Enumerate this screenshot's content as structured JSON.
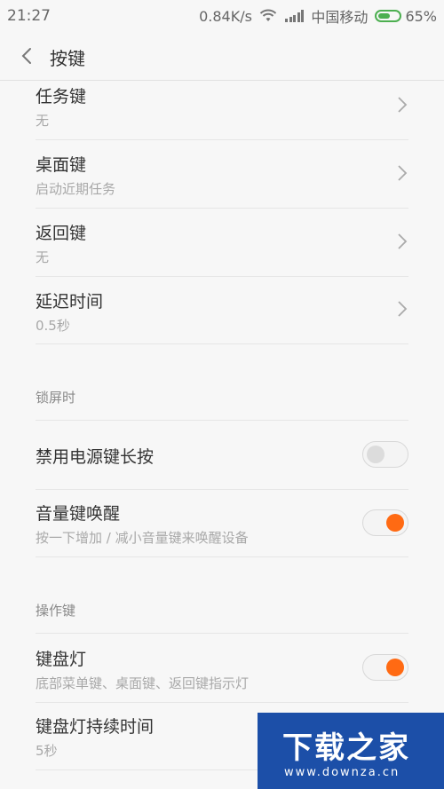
{
  "status_bar": {
    "time": "21:27",
    "speed": "0.84K/s",
    "carrier": "中国移动",
    "battery": "65%",
    "battery_level": 0.65
  },
  "header": {
    "title": "按键"
  },
  "items": [
    {
      "label": "任务键",
      "sub": "无"
    },
    {
      "label": "桌面键",
      "sub": "启动近期任务"
    },
    {
      "label": "返回键",
      "sub": "无"
    },
    {
      "label": "延迟时间",
      "sub": "0.5秒"
    }
  ],
  "lock_section": {
    "title": "锁屏时",
    "items": [
      {
        "label": "禁用电源键长按",
        "toggle": false
      },
      {
        "label": "音量键唤醒",
        "sub": "按一下增加 / 减小音量键来唤醒设备",
        "toggle": true
      }
    ]
  },
  "ops_section": {
    "title": "操作键",
    "items": [
      {
        "label": "键盘灯",
        "sub": "底部菜单键、桌面键、返回键指示灯",
        "toggle": true
      },
      {
        "label": "键盘灯持续时间",
        "sub": "5秒"
      }
    ]
  },
  "watermark": {
    "title": "下载之家",
    "url": "www.downza.cn"
  },
  "colors": {
    "accent": "#ff6a13",
    "watermark_bg": "#1c4fa8",
    "battery": "#4caf50"
  }
}
